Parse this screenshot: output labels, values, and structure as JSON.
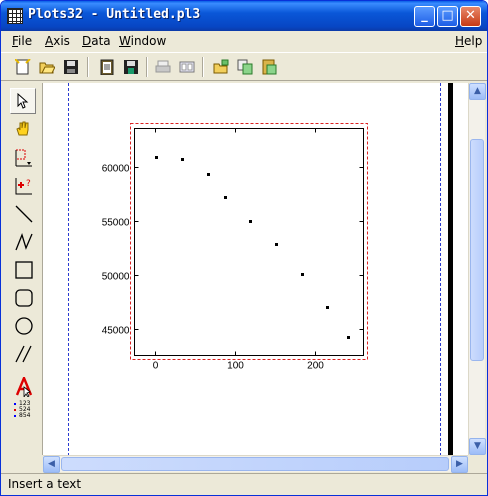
{
  "window": {
    "title": "Plots32 - Untitled.pl3"
  },
  "title_buttons": {
    "minimize": "_",
    "maximize": "□",
    "close": "✕"
  },
  "menu": {
    "file": {
      "ul": "F",
      "rest": "ile"
    },
    "axis": {
      "ul": "A",
      "rest": "xis"
    },
    "data": {
      "ul": "D",
      "rest": "ata"
    },
    "window": {
      "ul": "W",
      "rest": "indow"
    },
    "help": {
      "ul": "H",
      "rest": "elp"
    }
  },
  "toolbar_icons": [
    "new-doc-icon",
    "open-folder-icon",
    "save-disk-icon",
    "clipboard-icon",
    "save-as-icon",
    "print-icon",
    "preview-icon",
    "open-data-icon",
    "copy-data-icon",
    "paste-data-icon"
  ],
  "left_tools": [
    "pointer-icon",
    "hand-pan-icon",
    "zoom-rect-icon",
    "add-point-icon",
    "line-icon",
    "polyline-icon",
    "rectangle-icon",
    "rounded-rect-icon",
    "ellipse-icon",
    "hatch-lines-icon",
    "text-tool-icon",
    "data-table-icon"
  ],
  "data_table_icon_text": [
    "123",
    "524",
    "854"
  ],
  "status": {
    "text": "Insert a text"
  },
  "colors": {
    "title_blue": "#0a57d8",
    "frame_red": "#dd2222",
    "page_border_blue": "#2a3bd0"
  },
  "chart_data": {
    "type": "scatter",
    "title": "",
    "xlabel": "",
    "ylabel": "",
    "xlim": [
      -25,
      260
    ],
    "ylim": [
      42600,
      63500
    ],
    "x_ticks": [
      0,
      100,
      200
    ],
    "y_ticks": [
      45000,
      50000,
      55000,
      60000
    ],
    "x_tick_labels": [
      "0",
      "100",
      "200"
    ],
    "y_tick_labels": [
      "45000",
      "50000",
      "55000",
      "60000"
    ],
    "series": [
      {
        "x": [
          2,
          34,
          66,
          88,
          119,
          151,
          184,
          214,
          241
        ],
        "y": [
          60900,
          60700,
          59300,
          57200,
          55000,
          52900,
          50100,
          47100,
          44300
        ]
      }
    ],
    "grid": false,
    "legend": "none"
  }
}
